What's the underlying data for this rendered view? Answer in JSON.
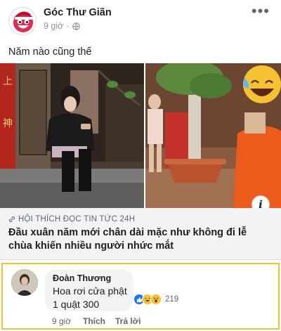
{
  "post": {
    "page_name": "Góc Thư Giãn",
    "time": "9 giờ",
    "separator": "·",
    "caption": "Năm nào cũng thế",
    "more": "•••"
  },
  "link": {
    "source": "HỘI THÍCH ĐỌC TIN TỨC 24H",
    "title": "Đầu xuân năm mới chân dài mặc như không đi lễ chùa khiến nhiều người nhức mắt",
    "info_label": "i"
  },
  "comment": {
    "author": "Đoàn Thương",
    "text_line1": "Hoa rơi cửa phật",
    "text_line2": "1 quật 300",
    "reaction_count": "219",
    "time": "9 giờ",
    "like": "Thích",
    "reply": "Trả lời"
  },
  "colors": {
    "highlight_border": "#f2c12e",
    "like_blue": "#1877f2",
    "emoji_yellow": "#f7c231"
  },
  "icons": [
    "page-avatar-icon",
    "globe-icon",
    "more-icon",
    "link-icon",
    "info-icon",
    "like-reaction-icon",
    "haha-reaction-icon",
    "wow-reaction-icon"
  ]
}
